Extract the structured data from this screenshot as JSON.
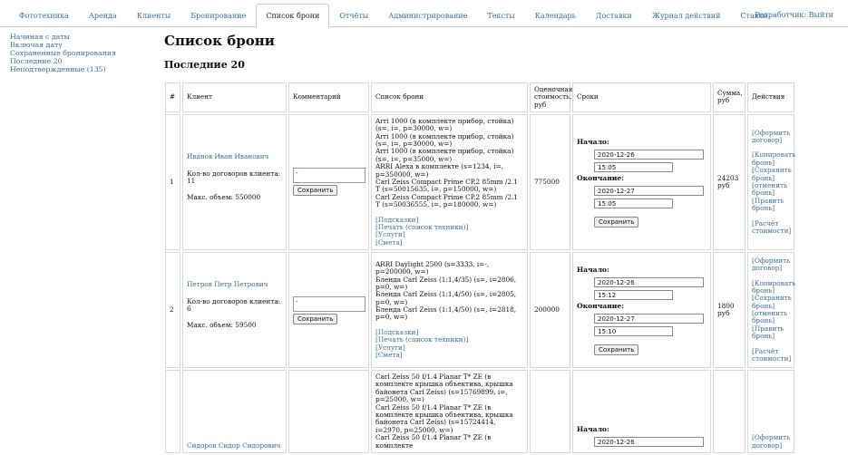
{
  "nav": {
    "tabs": [
      "Фототехника",
      "Аренда",
      "Клиенты",
      "Бронирование",
      "Список брони",
      "Отчёты",
      "Администрирование",
      "Тексты",
      "Календарь",
      "Доставки",
      "Журнал действий",
      "Ставки"
    ],
    "active_tab": "Список брони",
    "user_logout": "Разработчик: Выйти"
  },
  "sidebar": {
    "items": [
      "Начиная с даты",
      "Включая дату",
      "Сохраненные бронирования",
      "Последние 20",
      "Неподтвержденные (135)"
    ]
  },
  "page": {
    "title": "Список брони",
    "section_title": "Последние 20"
  },
  "table": {
    "headers": [
      "#",
      "Клиент",
      "Комментарий",
      "Список брони",
      "Оценочная стоимость, руб",
      "Сроки",
      "Сумма, руб",
      "Действия"
    ],
    "rows": [
      {
        "num": "1",
        "client_name": "Иванов Иван Иванович",
        "contracts": "Кол-во договоров клиента: 11",
        "max_volume": "Макс. объем: 550000",
        "comment": "-",
        "save_label": "Сохранить",
        "items": [
          "Arri 1000 (в комплекте прибор, стойка) (s=, i=, p=30000, w=)",
          "Arri 1000 (в комплекте прибор, стойка) (s=, i=, p=30000, w=)",
          "Arri 1000 (в комплекте прибор, стойка) (s=, i=, p=35000, w=)",
          "ARRI Alexa в комплекте (s=1234, i=, p=350000, w=)",
          "Carl Zeiss Compact Prime CP.2 85mm /2.1 T (s=50015635, i=, p=150000, w=)",
          "Carl Zeiss Compact Prime CP.2 85mm /2.1 T (s=50036555, i=, p=180000, w=)"
        ],
        "links": [
          "[Подсказки]",
          "[Печать (список техники)]",
          "[Услуги]",
          "[Смета]"
        ],
        "estimate": "775000",
        "start_label": "Начало:",
        "start_date": "2020-12-26",
        "start_time": "15:05",
        "end_label": "Окончание:",
        "end_date": "2020-12-27",
        "end_time": "15:05",
        "term_save": "Сохранить",
        "sum": "24203 руб",
        "actions": [
          "[Оформить договор]",
          "[Копировать бронь]",
          "[Сохранить бронь]",
          "[отменить бронь]",
          "[Править бронь]",
          "[Расчёт стоимости]"
        ]
      },
      {
        "num": "2",
        "client_name": "Петров Петр Петрович",
        "contracts": "Кол-во договоров клиента: 6",
        "max_volume": "Макс. объем: 59500",
        "comment": "-",
        "save_label": "Сохранить",
        "items": [
          "ARRI Daylight 2500 (s=3333, i=-, p=200000, w=)",
          "Бленда Carl Zeiss (1:1,4/35) (s=, i=2806, p=0, w=)",
          "Бленда Carl Zeiss (1:1,4/50) (s=, i=2805, p=0, w=)",
          "Бленда Carl Zeiss (1:1,4/50) (s=, i=2818, p=0, w=)"
        ],
        "links": [
          "[Подсказки]",
          "[Печать (список техники)]",
          "[Услуги]",
          "[Смета]"
        ],
        "estimate": "200000",
        "start_label": "Начало:",
        "start_date": "2020-12-26",
        "start_time": "15:12",
        "end_label": "Окончание:",
        "end_date": "2020-12-27",
        "end_time": "15:10",
        "term_save": "Сохранить",
        "sum": "1800 руб",
        "actions": [
          "[Оформить договор]",
          "[Копировать бронь]",
          "[Сохранить бронь]",
          "[отменить бронь]",
          "[Править бронь]",
          "[Расчёт стоимости]"
        ]
      },
      {
        "num": "",
        "client_name": "Сидоров Сидор Сидорович",
        "items": [
          "Carl Zeiss 50 f/1.4 Planar T* ZE (в комплекте крышка объектива, крышка байонета Carl Zeiss) (s=15769899, i=, p=25000, w=)",
          "Carl Zeiss 50 f/1.4 Planar T* ZE (в комплекте крышка объектива, крышка байонета Carl Zeiss) (s=15724414, i=2970, p=25000, w=)",
          "Carl Zeiss 50 f/1.4 Planar T* ZE (в комплекте"
        ],
        "start_label": "Начало:",
        "start_date": "2020-12-26",
        "actions": [
          "[Оформить договор]"
        ]
      }
    ]
  }
}
